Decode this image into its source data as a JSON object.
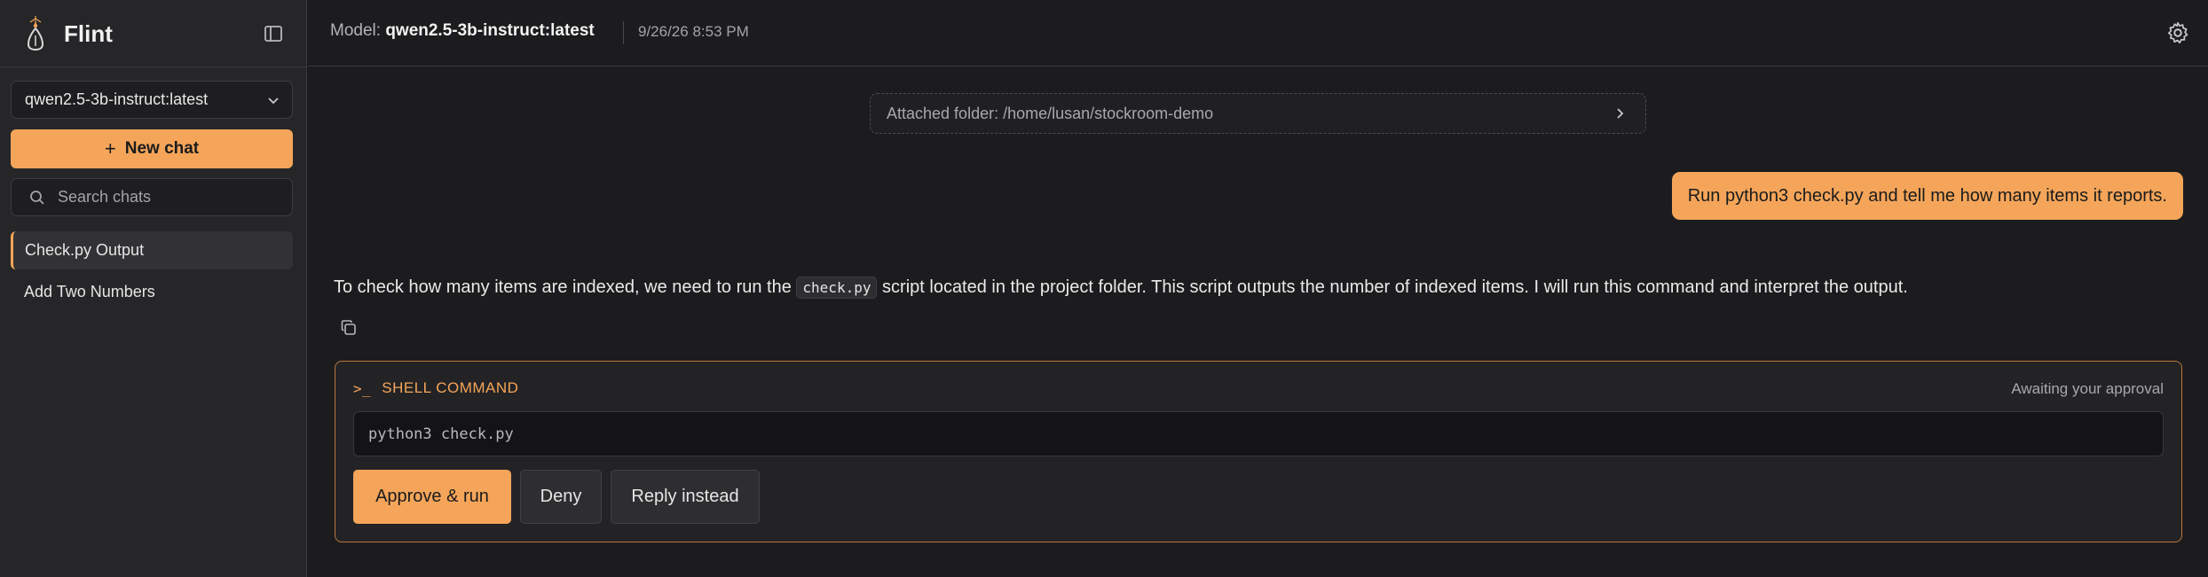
{
  "app": {
    "name": "Flint",
    "accent_color": "#f4a55a"
  },
  "sidebar": {
    "model_select": {
      "value": "qwen2.5-3b-instruct:latest"
    },
    "new_chat_label": "New chat",
    "search_placeholder": "Search chats",
    "chats": [
      {
        "label": "Check.py Output",
        "active": true
      },
      {
        "label": "Add Two Numbers",
        "active": false
      }
    ]
  },
  "header": {
    "model_prefix": "Model:",
    "model_name": "qwen2.5-3b-instruct:latest",
    "timestamp": "9/26/26 8:53 PM"
  },
  "conversation": {
    "attached_folder": "Attached folder: /home/lusan/stockroom-demo",
    "user_message": "Run python3 check.py and tell me how many items it reports.",
    "assistant_text_before": "To check how many items are indexed, we need to run the",
    "assistant_code": "check.py",
    "assistant_text_after": "script located in the project folder. This script outputs the number of indexed items. I will run this command and interpret the output."
  },
  "shell_card": {
    "title": "SHELL COMMAND",
    "status": "Awaiting your approval",
    "command": "python3 check.py",
    "approve_label": "Approve & run",
    "deny_label": "Deny",
    "reply_label": "Reply instead"
  }
}
